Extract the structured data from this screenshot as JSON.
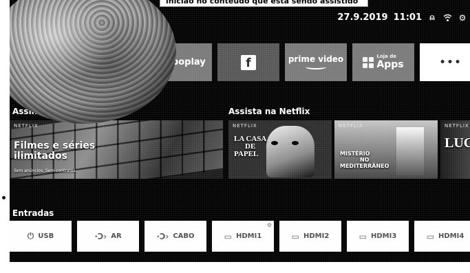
{
  "tooltip": "inicião no conteúdo que está sendo assistido",
  "status": {
    "date": "27.9.2019",
    "time": "11:01"
  },
  "status_icons": [
    "user-icon",
    "wifi-icon",
    "settings-icon"
  ],
  "apps": {
    "globoplay": "globoplay",
    "facebook": "f",
    "prime_video": "prime video",
    "apps_sub": "Loja de",
    "apps": "Apps",
    "more": "•••"
  },
  "sections": {
    "subscribe": "Assine já",
    "netflix": "Assista na Netflix",
    "inputs": "Entradas"
  },
  "cards": {
    "netflix_tag": "NETFLIX",
    "promo_title_1": "Filmes e séries",
    "promo_title_2": "ilimitados",
    "promo_sub": "Sem anúncios. Sem contratos.",
    "casa_1": "LA CASA",
    "casa_2": "DE",
    "casa_3": "PAPEL",
    "misterio_1": "MISTÉRIO",
    "misterio_2": "NO",
    "misterio_3": "MEDITERRÂNEO",
    "lucifer": "LUCI"
  },
  "inputs": [
    {
      "icon": "usb-icon",
      "glyph": "⏻",
      "label": "USB"
    },
    {
      "icon": "antenna-icon",
      "glyph": "·Ͻ›",
      "label": "AR"
    },
    {
      "icon": "cable-icon",
      "glyph": "·Ͻ›",
      "label": "CABO"
    },
    {
      "icon": "hdmi-icon",
      "glyph": "▭",
      "label": "HDMI1"
    },
    {
      "icon": "hdmi-icon",
      "glyph": "▭",
      "label": "HDMI2"
    },
    {
      "icon": "hdmi-icon",
      "glyph": "▭",
      "label": "HDMI3"
    },
    {
      "icon": "hdmi-icon",
      "glyph": "▭",
      "label": "HDMI4"
    }
  ]
}
